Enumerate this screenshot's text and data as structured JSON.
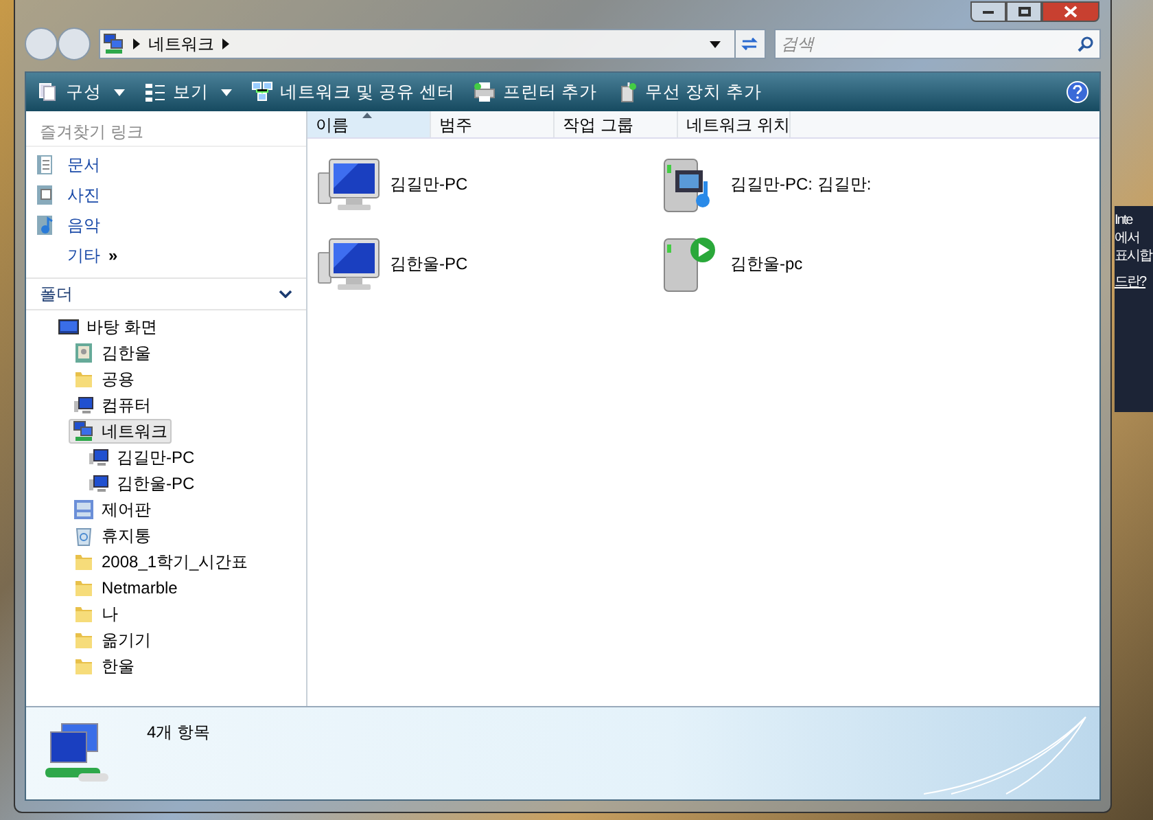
{
  "address_bar": {
    "path": [
      {
        "label": "네트워크"
      }
    ]
  },
  "search": {
    "placeholder": "검색"
  },
  "toolbar": [
    {
      "label": "구성",
      "kind": "organize",
      "dropdown": true
    },
    {
      "label": "보기",
      "kind": "views",
      "dropdown": true
    },
    {
      "label": "네트워크 및 공유 센터",
      "kind": "network-center",
      "dropdown": false
    },
    {
      "label": "프린터 추가",
      "kind": "printer",
      "dropdown": false
    },
    {
      "label": "무선 장치 추가",
      "kind": "wireless",
      "dropdown": false
    }
  ],
  "favorites": {
    "title": "즐겨찾기 링크",
    "items": [
      {
        "label": "문서",
        "kind": "documents"
      },
      {
        "label": "사진",
        "kind": "pictures"
      },
      {
        "label": "음악",
        "kind": "music"
      }
    ],
    "more": {
      "label": "기타",
      "glyph": "»"
    }
  },
  "folders": {
    "title": "폴더",
    "expanded": true,
    "tree": [
      {
        "label": "바탕 화면",
        "kind": "desktop",
        "selected": false,
        "children": [
          {
            "label": "김한울",
            "kind": "user",
            "selected": false
          },
          {
            "label": "공용",
            "kind": "folder",
            "selected": false
          },
          {
            "label": "컴퓨터",
            "kind": "computer",
            "selected": false
          },
          {
            "label": "네트워크",
            "kind": "network",
            "selected": true,
            "children": [
              {
                "label": "김길만-PC",
                "kind": "computer",
                "selected": false
              },
              {
                "label": "김한울-PC",
                "kind": "computer",
                "selected": false
              }
            ]
          },
          {
            "label": "제어판",
            "kind": "control-panel",
            "selected": false
          },
          {
            "label": "휴지통",
            "kind": "recycle-bin",
            "selected": false
          },
          {
            "label": "2008_1학기_시간표",
            "kind": "folder",
            "selected": false
          },
          {
            "label": "Netmarble",
            "kind": "folder",
            "selected": false
          },
          {
            "label": "나",
            "kind": "folder",
            "selected": false
          },
          {
            "label": "옮기기",
            "kind": "folder",
            "selected": false
          },
          {
            "label": "한울",
            "kind": "folder",
            "selected": false
          }
        ]
      }
    ]
  },
  "table": {
    "columns": [
      {
        "label": "이름",
        "sorted": true
      },
      {
        "label": "범주",
        "sorted": false
      },
      {
        "label": "작업 그룹",
        "sorted": false
      },
      {
        "label": "네트워크 위치",
        "sorted": false
      }
    ]
  },
  "items": [
    {
      "label": "김길만-PC",
      "kind": "computer"
    },
    {
      "label": "김길만-PC: 김길만:",
      "kind": "media-server"
    },
    {
      "label": "김한울-PC",
      "kind": "computer"
    },
    {
      "label": "김한울-pc",
      "kind": "media-player"
    }
  ],
  "status_bar": {
    "text": "4개 항목"
  },
  "desktop_gadget": {
    "lines": [
      "Inte",
      "에서",
      "표시합",
      "드란?"
    ]
  }
}
